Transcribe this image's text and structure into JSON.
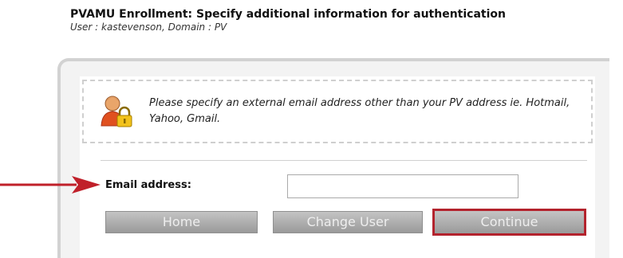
{
  "header": {
    "title": "PVAMU Enrollment: Specify additional information for authentication",
    "subtitle": "User : kastevenson, Domain : PV"
  },
  "notice": {
    "icon": "user-lock-icon",
    "text": "Please specify an external email address other than your PV address ie. Hotmail, Yahoo, Gmail."
  },
  "form": {
    "email_label": "Email address:",
    "email_value": ""
  },
  "buttons": {
    "home": "Home",
    "change_user": "Change User",
    "continue": "Continue"
  },
  "colors": {
    "highlight": "#b3232d",
    "button_bg": "#a8a8a8",
    "panel_border": "#d2d2d2"
  }
}
